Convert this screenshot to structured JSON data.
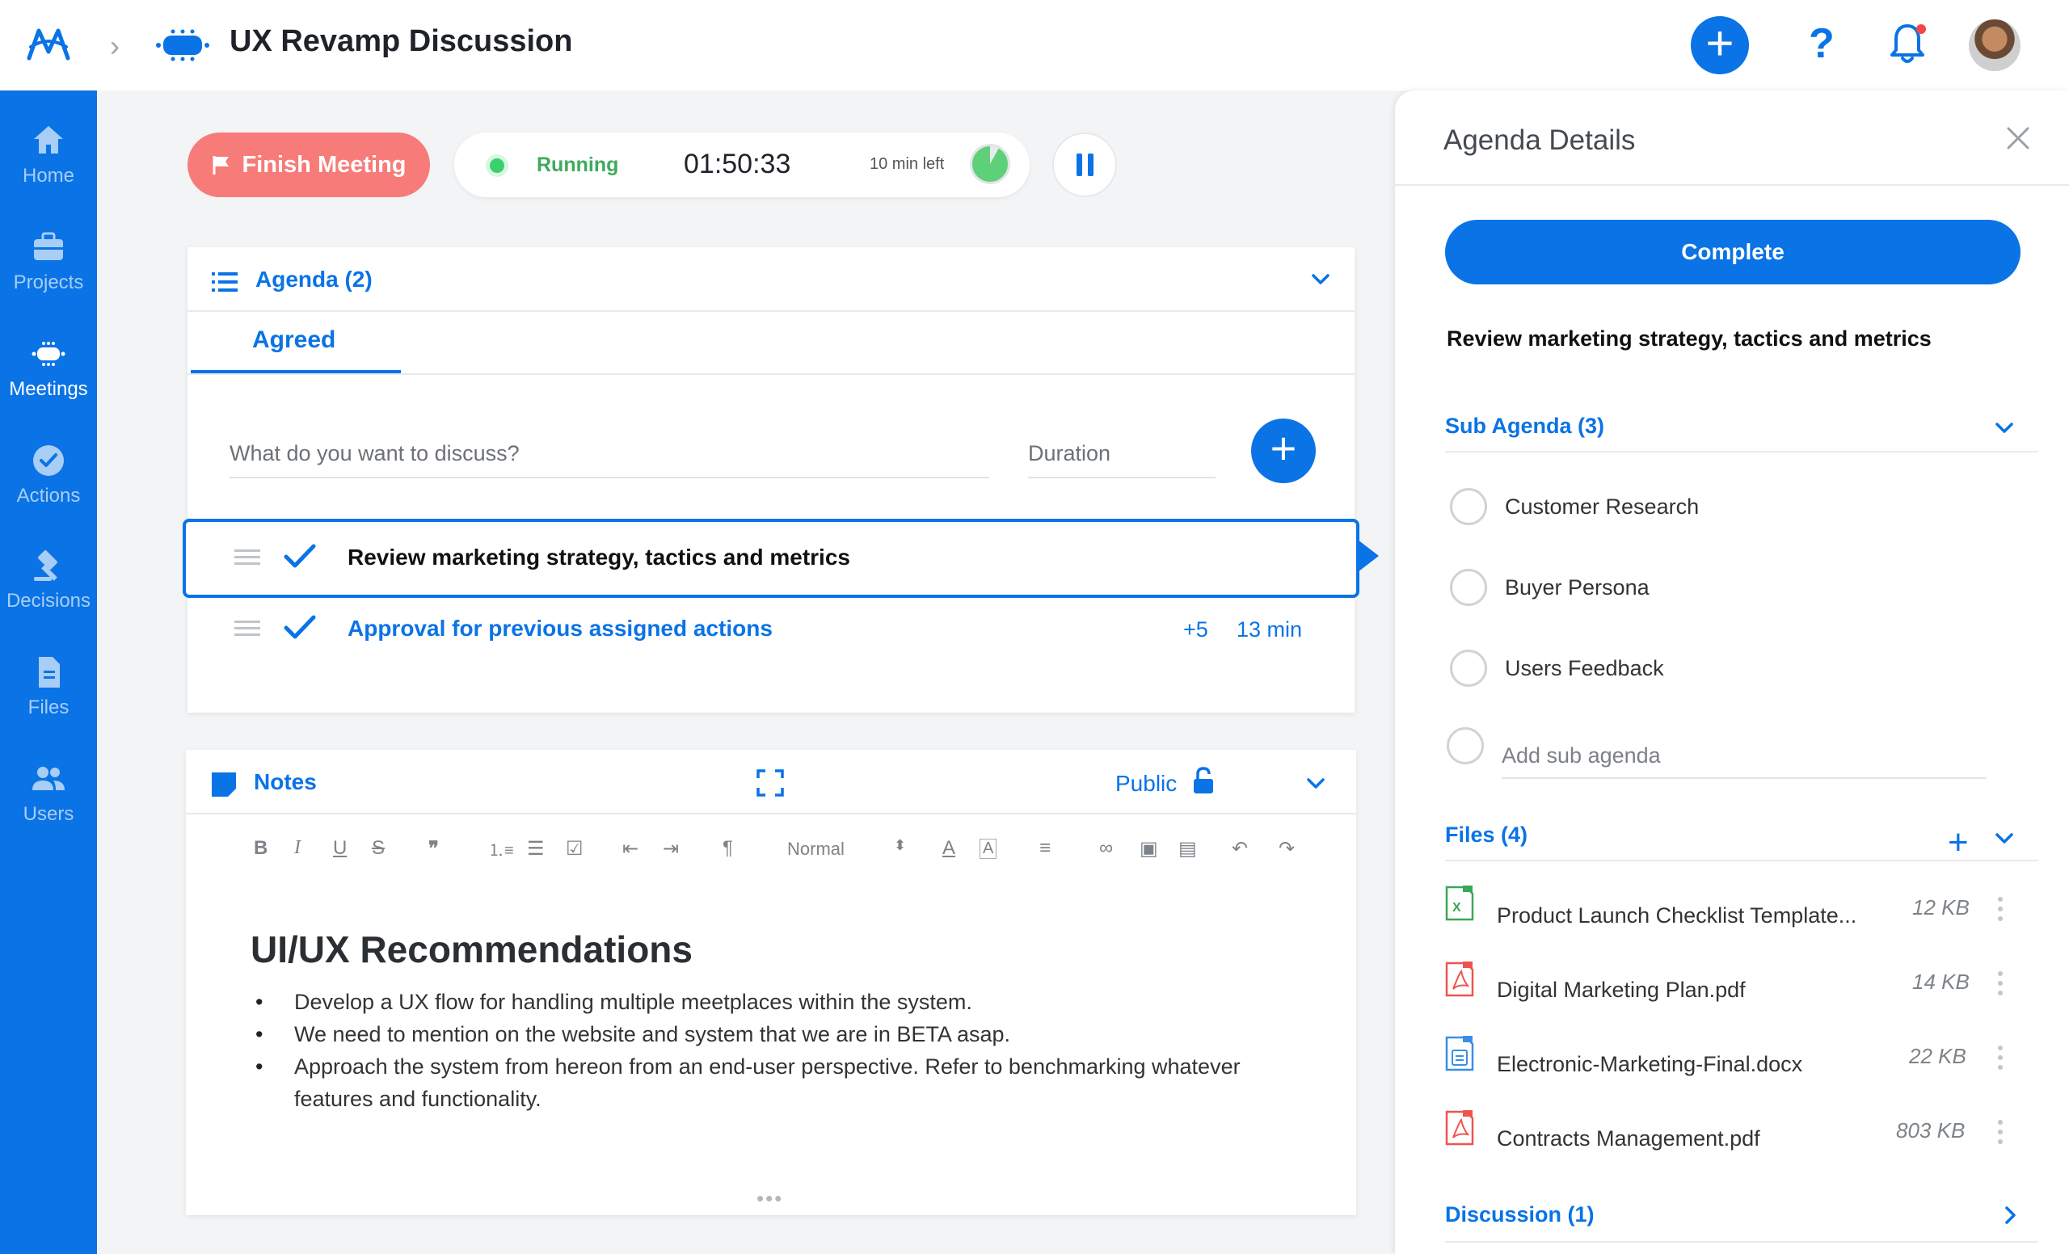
{
  "header": {
    "title": "UX Revamp Discussion",
    "icons": [
      "app-logo-icon",
      "chevron-right-icon",
      "meeting-icon",
      "plus-icon",
      "help-icon",
      "bell-icon",
      "avatar"
    ]
  },
  "sidebar": {
    "items": [
      {
        "label": "Home",
        "icon": "home-icon",
        "active": false
      },
      {
        "label": "Projects",
        "icon": "briefcase-icon",
        "active": false
      },
      {
        "label": "Meetings",
        "icon": "meeting-icon",
        "active": true
      },
      {
        "label": "Actions",
        "icon": "check-circle-icon",
        "active": false
      },
      {
        "label": "Decisions",
        "icon": "gavel-icon",
        "active": false
      },
      {
        "label": "Files",
        "icon": "file-icon",
        "active": false
      },
      {
        "label": "Users",
        "icon": "users-icon",
        "active": false
      }
    ]
  },
  "controls": {
    "finish_label": "Finish Meeting",
    "status": "Running",
    "elapsed": "01:50:33",
    "time_left": "10 min left",
    "time_left_fraction": 0.92
  },
  "agenda": {
    "title": "Agenda (2)",
    "tab": "Agreed",
    "discuss_placeholder": "What do you want to discuss?",
    "duration_placeholder": "Duration",
    "items": [
      {
        "text": "Review marketing strategy, tactics and metrics",
        "selected": true
      },
      {
        "text": "Approval for previous assigned actions",
        "count": "+5",
        "duration": "13 min"
      }
    ]
  },
  "notes": {
    "title": "Notes",
    "visibility": "Public",
    "toolbar": {
      "format": "Normal"
    },
    "heading": "UI/UX Recommendations",
    "bullets": [
      "Develop a UX flow for handling multiple meetplaces within the system.",
      "We need to mention on the website and system that we are in BETA asap.",
      "Approach the system from hereon from an end-user perspective. Refer to benchmarking whatever features and functionality."
    ]
  },
  "panel": {
    "title": "Agenda Details",
    "complete_label": "Complete",
    "agenda_title": "Review marketing strategy, tactics and metrics",
    "sub_agenda_title": "Sub Agenda (3)",
    "sub_items": [
      "Customer Research",
      "Buyer Persona",
      "Users Feedback"
    ],
    "add_sub_placeholder": "Add sub agenda",
    "files_title": "Files (4)",
    "files": [
      {
        "name": "Product Launch Checklist Template...",
        "size": "12 KB",
        "type": "excel"
      },
      {
        "name": "Digital Marketing Plan.pdf",
        "size": "14 KB",
        "type": "pdf"
      },
      {
        "name": "Electronic-Marketing-Final.docx",
        "size": "22 KB",
        "type": "doc"
      },
      {
        "name": "Contracts Management.pdf",
        "size": "803 KB",
        "type": "pdf"
      }
    ],
    "discussion_title": "Discussion (1)"
  },
  "colors": {
    "primary": "#0a73e6",
    "danger": "#f77b78",
    "running": "#3daa5e",
    "background": "#f3f4f6"
  }
}
